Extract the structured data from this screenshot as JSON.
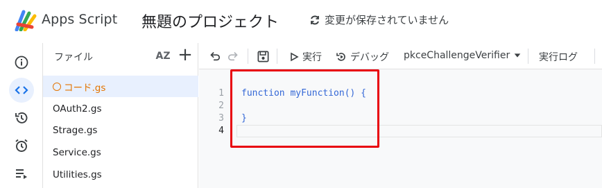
{
  "header": {
    "app_name": "Apps Script",
    "project_title": "無題のプロジェクト",
    "save_status": "変更が保存されていません"
  },
  "rail": {
    "items": [
      {
        "icon": "info-icon",
        "label": "概要"
      },
      {
        "icon": "code-icon",
        "label": "エディタ",
        "active": true
      },
      {
        "icon": "history-icon",
        "label": "実行数"
      },
      {
        "icon": "alarm-icon",
        "label": "トリガー"
      },
      {
        "icon": "executions-icon",
        "label": "実行"
      }
    ]
  },
  "files": {
    "title": "ファイル",
    "sort_label": "AZ",
    "add_label": "+",
    "items": [
      {
        "name": "コード.gs",
        "selected": true,
        "unsaved": true
      },
      {
        "name": "OAuth2.gs"
      },
      {
        "name": "Strage.gs"
      },
      {
        "name": "Service.gs"
      },
      {
        "name": "Utilities.gs"
      }
    ]
  },
  "toolbar": {
    "run_label": "実行",
    "debug_label": "デバッグ",
    "function_select": "pkceChallengeVerifier",
    "log_label": "実行ログ"
  },
  "editor": {
    "line_numbers": [
      "1",
      "2",
      "3",
      "4"
    ],
    "lines": [
      "function myFunction() {",
      "",
      "}",
      ""
    ],
    "current_line": 4
  },
  "colors": {
    "accent": "#1a73e8",
    "active_bg": "#e8f0fe",
    "unsaved": "#e37400",
    "highlight": "#e8000c",
    "code_keyword": "#3367d6"
  }
}
